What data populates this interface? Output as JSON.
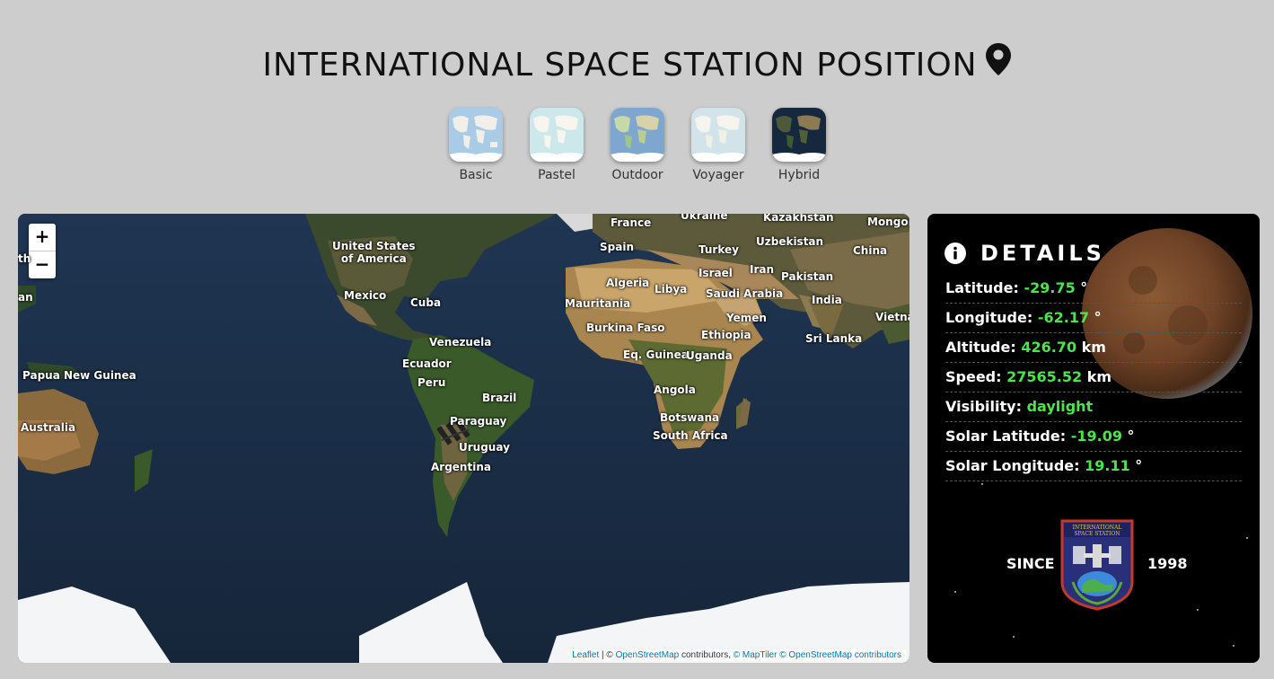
{
  "header": {
    "title": "INTERNATIONAL SPACE STATION POSITION",
    "icon": "map-marker-icon"
  },
  "layers": [
    {
      "label": "Basic"
    },
    {
      "label": "Pastel"
    },
    {
      "label": "Outdoor"
    },
    {
      "label": "Voyager"
    },
    {
      "label": "Hybrid"
    }
  ],
  "map": {
    "zoom_in": "+",
    "zoom_out": "−",
    "labels": {
      "france": "France",
      "ukraine": "Ukraine",
      "kazakhstan": "Kazakhstan",
      "mongolia": "Mongoli",
      "usa": "United States\nof America",
      "spain": "Spain",
      "turkey": "Turkey",
      "uzbekistan": "Uzbekistan",
      "china": "China",
      "israel": "Israel",
      "iran": "Iran",
      "pakistan": "Pakistan",
      "mexico": "Mexico",
      "cuba": "Cuba",
      "algeria": "Algeria",
      "libya": "Libya",
      "saudi": "Saudi Arabia",
      "india": "India",
      "mauritania": "Mauritania",
      "vietnam": "Vietna",
      "burkina": "Burkina Faso",
      "yemen": "Yemen",
      "venezuela": "Venezuela",
      "ethiopia": "Ethiopia",
      "srilanka": "Sri Lanka",
      "png": "Papua New Guinea",
      "ecuador": "Ecuador",
      "eqguinea": "Eq. Guinea",
      "uganda": "Uganda",
      "peru": "Peru",
      "brazil": "Brazil",
      "angola": "Angola",
      "australia": "Australia",
      "paraguay": "Paraguay",
      "botswana": "Botswana",
      "southafrica": "South Africa",
      "uruguay": "Uruguay",
      "argentina": "Argentina",
      "an": "an",
      "th": "th"
    },
    "attribution": {
      "leaflet": "Leaflet",
      "sep1": " | © ",
      "osm": "OpenStreetMap",
      "contrib": " contributors, ",
      "maptiler": "© MapTiler",
      "osm2": "© OpenStreetMap contributors"
    }
  },
  "details": {
    "title": "DETAILS",
    "rows": [
      {
        "label": "Latitude:",
        "value": "-29.75",
        "unit": "°"
      },
      {
        "label": "Longitude:",
        "value": "-62.17",
        "unit": "°"
      },
      {
        "label": "Altitude:",
        "value": "426.70",
        "unit": "km"
      },
      {
        "label": "Speed:",
        "value": "27565.52",
        "unit": "km"
      },
      {
        "label": "Visibility:",
        "value": "daylight",
        "unit": ""
      },
      {
        "label": "Solar Latitude:",
        "value": "-19.09",
        "unit": "°"
      },
      {
        "label": "Solar Longitude:",
        "value": "19.11",
        "unit": "°"
      }
    ],
    "since_label": "SINCE",
    "since_year": "1998",
    "patch_text_top": "INTERNATIONAL",
    "patch_text_bottom": "SPACE STATION"
  },
  "colors": {
    "value_green": "#4ee24e",
    "panel_bg": "#000000",
    "page_bg": "#cdcdcd"
  }
}
